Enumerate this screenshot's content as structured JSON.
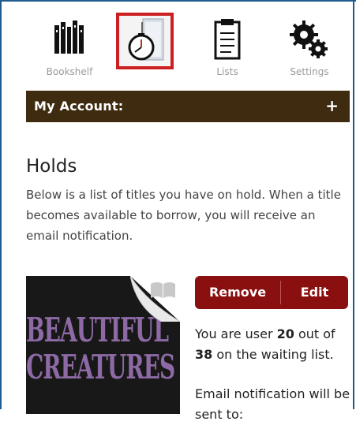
{
  "nav": {
    "bookshelf_label": "Bookshelf",
    "lists_label": "Lists",
    "settings_label": "Settings"
  },
  "account": {
    "title": "My Account:",
    "toggle": "+"
  },
  "holds": {
    "title": "Holds",
    "description": "Below is a list of titles you have on hold. When a title becomes available to borrow, you will receive an email notification."
  },
  "book": {
    "cover_line1": "BEAUTIFUL",
    "cover_line2": "CREATURES",
    "remove_label": "Remove",
    "edit_label": "Edit",
    "waiting_prefix": "You are user ",
    "position": "20",
    "waiting_mid": " out of ",
    "total": "38",
    "waiting_suffix": " on the waiting list.",
    "email_text": "Email notification will be sent to:"
  },
  "colors": {
    "accent_red": "#8a0f0f",
    "account_bar": "#3e2b10",
    "highlight": "#cc1f1f"
  }
}
